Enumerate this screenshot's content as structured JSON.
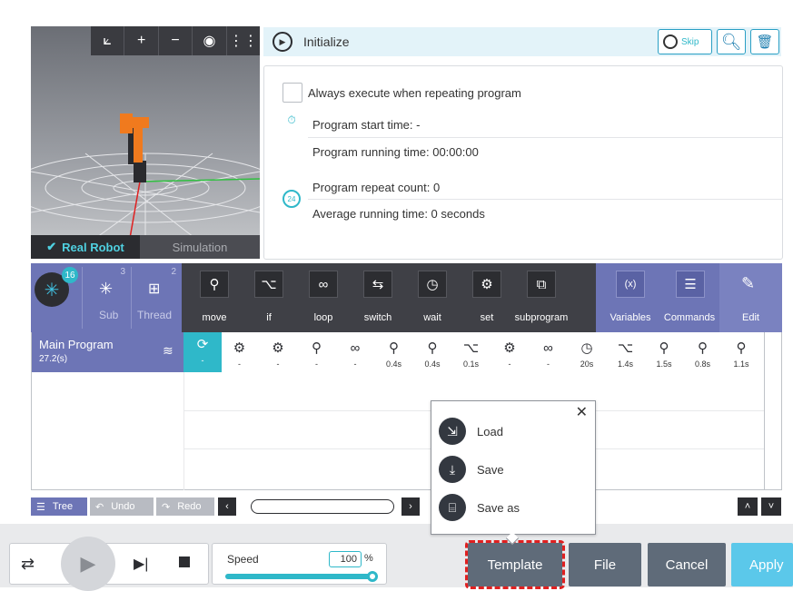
{
  "viewer": {
    "tools": [
      "⟀",
      "+",
      "−",
      "◉",
      "⋮⋮"
    ],
    "tab_real": "Real Robot",
    "tab_sim": "Simulation"
  },
  "header": {
    "title": "Initialize",
    "skip": "Skip"
  },
  "init": {
    "always_execute": "Always execute when repeating program",
    "start_time": "Program start time: -",
    "running_time": "Program running time:  00:00:00",
    "repeat_count": "Program repeat count: 0",
    "avg_time": "Average running time: 0 seconds",
    "repeat_badge": "24"
  },
  "palette": {
    "main_badge": "16",
    "sub_badge": "3",
    "thread_badge": "2",
    "sub": "Sub",
    "thread": "Thread",
    "items": [
      "move",
      "if",
      "loop",
      "switch",
      "wait",
      "set",
      "subprogram"
    ],
    "variables": "Variables",
    "commands": "Commands",
    "edit": "Edit"
  },
  "program": {
    "name": "Main Program",
    "duration": "27.2(s)",
    "commands": [
      {
        "icon": "init-icon",
        "time": "-"
      },
      {
        "icon": "set-icon",
        "time": "-"
      },
      {
        "icon": "set-icon",
        "time": "-"
      },
      {
        "icon": "movej-icon",
        "time": "-"
      },
      {
        "icon": "loop-icon",
        "time": "-"
      },
      {
        "icon": "movel-icon",
        "time": "0.4s"
      },
      {
        "icon": "movel-icon",
        "time": "0.4s"
      },
      {
        "icon": "if-icon",
        "time": "0.1s"
      },
      {
        "icon": "set-icon",
        "time": "-"
      },
      {
        "icon": "loop-icon",
        "time": "-"
      },
      {
        "icon": "wait-icon",
        "time": "20s"
      },
      {
        "icon": "if-icon",
        "time": "1.4s"
      },
      {
        "icon": "movel-icon",
        "time": "1.5s"
      },
      {
        "icon": "movej-icon",
        "time": "0.8s"
      },
      {
        "icon": "movel-icon",
        "time": "1.1s"
      }
    ]
  },
  "toolbar": {
    "tree": "Tree",
    "undo": "Undo",
    "redo": "Redo"
  },
  "popup": {
    "load": "Load",
    "save": "Save",
    "save_as": "Save as"
  },
  "footer": {
    "speed_label": "Speed",
    "speed_value": "100",
    "speed_unit": "%",
    "speed_level": 1.0,
    "template": "Template",
    "file": "File",
    "cancel": "Cancel",
    "apply": "Apply"
  },
  "colors": {
    "accent": "#2fb8c9",
    "program": "#6d75b6",
    "button_dark": "#5f6b79",
    "apply": "#5bc8ea",
    "highlight": "#e02020"
  }
}
